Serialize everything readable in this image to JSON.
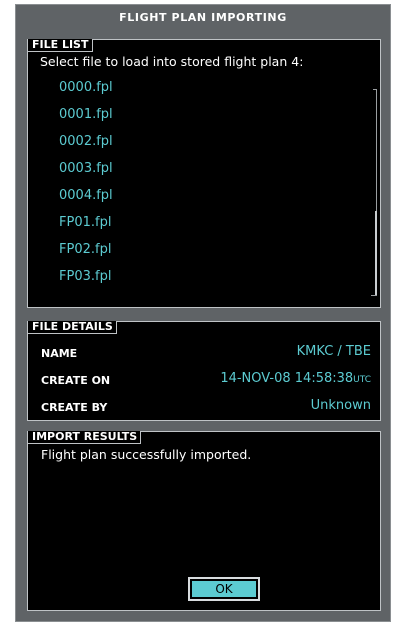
{
  "window": {
    "title": "FLIGHT PLAN IMPORTING"
  },
  "file_list": {
    "label": "FILE LIST",
    "prompt": "Select file to load into stored flight plan 4:",
    "files": [
      "0000.fpl",
      "0001.fpl",
      "0002.fpl",
      "0003.fpl",
      "0004.fpl",
      "FP01.fpl",
      "FP02.fpl",
      "FP03.fpl"
    ]
  },
  "file_details": {
    "label": "FILE DETAILS",
    "name_label": "NAME",
    "name_value": "KMKC / TBE",
    "create_on_label": "CREATE ON",
    "create_on_value": "14-NOV-08 14:58:38",
    "create_on_suffix": "UTC",
    "create_by_label": "CREATE BY",
    "create_by_value": "Unknown"
  },
  "import_results": {
    "label": "IMPORT RESULTS",
    "message": "Flight plan successfully imported.",
    "ok_label": "OK"
  },
  "colors": {
    "panel_background": "#000000",
    "frame_gray": "#5f6366",
    "accent_cyan": "#5ccbd1",
    "text_white": "#ffffff"
  }
}
